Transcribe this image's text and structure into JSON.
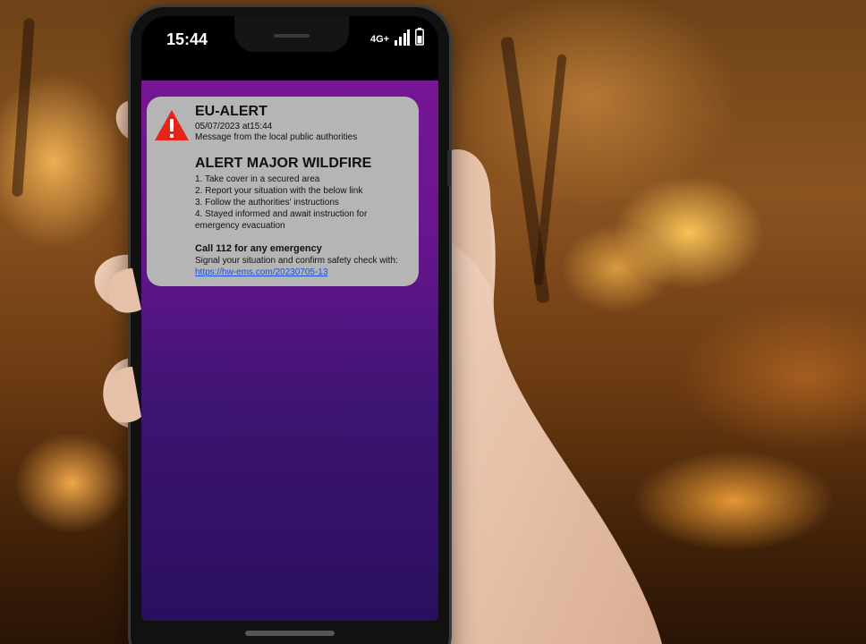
{
  "status_bar": {
    "time": "15:44",
    "network": "4G+"
  },
  "alert": {
    "title": "EU-ALERT",
    "timestamp": "05/07/2023 at15:44",
    "source": "Message from the local public authorities",
    "headline": "ALERT MAJOR WILDFIRE",
    "instructions": [
      "1. Take cover in a secured area",
      "2. Report your situation with the below link",
      "3. Follow the authorities' instructions",
      "4. Stayed informed and await instruction for emergency evacuation"
    ],
    "emergency_call": "Call 112 for any emergency",
    "signal_text": "Signal your situation and confirm safety check with:",
    "link": "https://hw-ems.com/20230705-13"
  },
  "icons": {
    "warning": "warning-triangle-icon",
    "signal": "cell-signal-icon",
    "battery": "battery-icon"
  },
  "colors": {
    "screen_top": "#7b1796",
    "screen_bottom": "#2a0f5e",
    "alert_card": "#b5b5b5",
    "warning_red": "#e32619",
    "link": "#1a4fd8"
  }
}
